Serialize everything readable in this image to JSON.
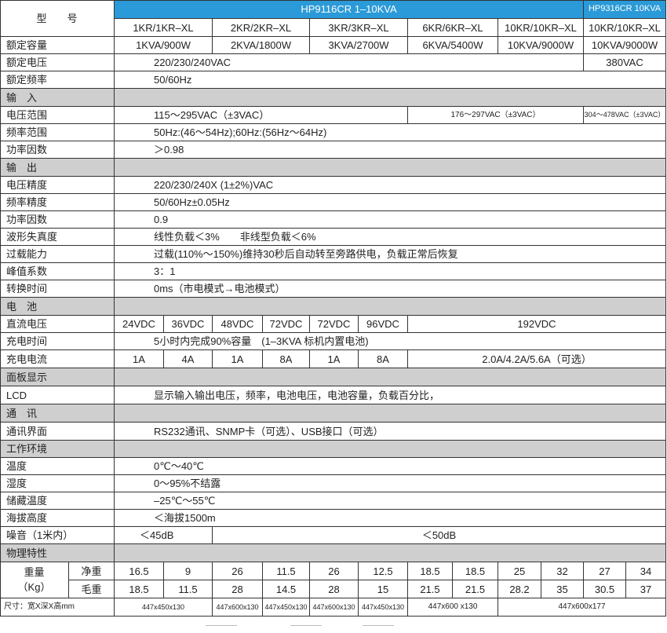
{
  "header": {
    "model_label": "型　　号",
    "series_a": "HP9116CR 1–10KVA",
    "series_b": "HP9316CR 10KVA",
    "models": [
      "1KR/1KR–XL",
      "2KR/2KR–XL",
      "3KR/3KR–XL",
      "6KR/6KR–XL",
      "10KR/10KR–XL",
      "10KR/10KR–XL"
    ]
  },
  "rated": {
    "capacity_label": "额定容量",
    "capacity": [
      "1KVA/900W",
      "2KVA/1800W",
      "3KVA/2700W",
      "6KVA/5400W",
      "10KVA/9000W",
      "10KVA/9000W"
    ],
    "voltage_label": "额定电压",
    "voltage_a": "220/230/240VAC",
    "voltage_b": "380VAC",
    "frequency_label": "额定频率",
    "frequency": "50/60Hz"
  },
  "input": {
    "title": "输　入",
    "vrange_label": "电压范围",
    "vrange_a": "115～295VAC（±3VAC）",
    "vrange_b": "176～297VAC（±3VAC）",
    "vrange_c": "304～478VAC（±3VAC）",
    "frange_label": "频率范围",
    "frange": "50Hz:(46～54Hz);60Hz:(56Hz～64Hz)",
    "pf_label": "功率因数",
    "pf": "＞0.98"
  },
  "output": {
    "title": "输　出",
    "vacc_label": "电压精度",
    "vacc": "220/230/240X (1±2%)VAC",
    "facc_label": "频率精度",
    "facc": "50/60Hz±0.05Hz",
    "pf_label": "功率因数",
    "pf": "0.9",
    "thd_label": "波形失真度",
    "thd": "线性负载＜3%　　非线型负载＜6%",
    "overload_label": "过载能力",
    "overload": "过载(110%～150%)维持30秒后自动转至旁路供电，负载正常后恢复",
    "crest_label": "峰值系数",
    "crest": "3：1",
    "transfer_label": "转换时间",
    "transfer": "0ms（市电模式→电池模式）"
  },
  "battery": {
    "title": "电　池",
    "dcv_label": "直流电压",
    "dcv": [
      "24VDC",
      "36VDC",
      "48VDC",
      "72VDC",
      "72VDC",
      "96VDC",
      "192VDC"
    ],
    "charge_time_label": "充电时间",
    "charge_time": "5小时内完成90%容量　(1–3KVA 标机内置电池)",
    "charge_current_label": "充电电流",
    "charge_current": [
      "1A",
      "4A",
      "1A",
      "8A",
      "1A",
      "8A",
      "2.0A/4.2A/5.6A（可选）"
    ]
  },
  "panel": {
    "title": "面板显示",
    "lcd_label": "LCD",
    "lcd": "显示输入输出电压，频率，电池电压，电池容量，负载百分比，"
  },
  "comm": {
    "title": "通　讯",
    "iface_label": "通讯界面",
    "iface": "RS232通讯、SNMP卡（可选）、USB接口（可选）"
  },
  "env": {
    "title": "工作环境",
    "temp_label": "温度",
    "temp": "0℃～40℃",
    "humidity_label": "湿度",
    "humidity": "0～95%不结露",
    "storage_label": "储藏温度",
    "storage": "–25℃～55℃",
    "altitude_label": "海拔高度",
    "altitude": "＜海拔1500m",
    "noise_label": "噪音（1米内）",
    "noise_a": "＜45dB",
    "noise_b": "＜50dB"
  },
  "physical": {
    "title": "物理特性",
    "weight_label": "重量",
    "weight_unit": "（Kg）",
    "net_label": "净重",
    "net": [
      "16.5",
      "9",
      "26",
      "11.5",
      "26",
      "12.5",
      "18.5",
      "18.5",
      "25",
      "32",
      "27",
      "34"
    ],
    "gross_label": "毛重",
    "gross": [
      "18.5",
      "11.5",
      "28",
      "14.5",
      "28",
      "15",
      "21.5",
      "21.5",
      "28.2",
      "35",
      "30.5",
      "37"
    ],
    "size_label": "尺寸：宽X深X高mm",
    "size": [
      "447x450x130",
      "447x600x130",
      "447x450x130",
      "447x600x130",
      "447x450x130",
      "447x600 x130",
      "447x600x177"
    ]
  }
}
